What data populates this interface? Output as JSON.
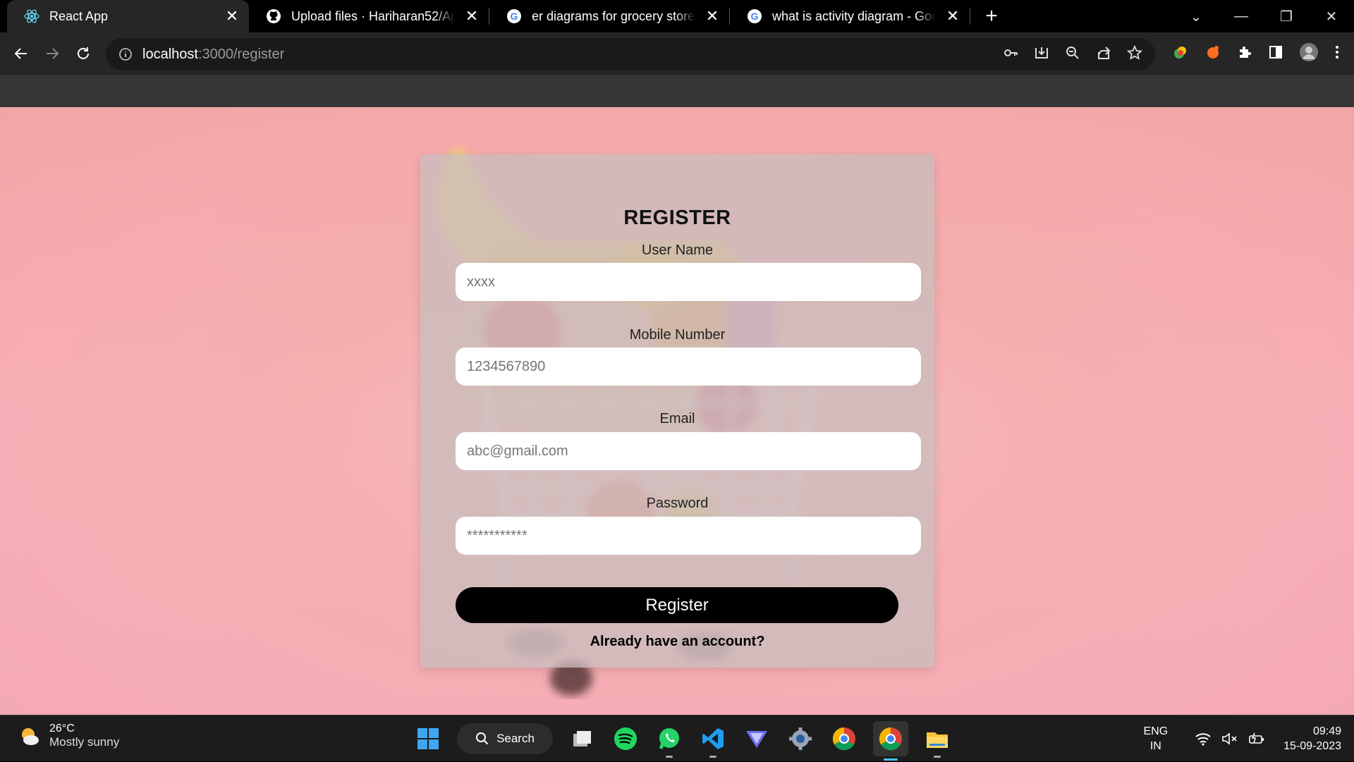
{
  "browser": {
    "tabs": [
      {
        "title": "React App",
        "favicon": "react-icon",
        "active": true
      },
      {
        "title": "Upload files · Hariharan52/AppDe",
        "favicon": "github-icon",
        "active": false
      },
      {
        "title": "er diagrams for grocery store - G",
        "favicon": "google-icon",
        "active": false
      },
      {
        "title": "what is activity diagram - Google",
        "favicon": "google-icon",
        "active": false
      }
    ],
    "url_host": "localhost",
    "url_path": ":3000/register"
  },
  "form": {
    "heading": "REGISTER",
    "username_label": "User Name",
    "username_placeholder": "xxxx",
    "mobile_label": "Mobile Number",
    "mobile_placeholder": "1234567890",
    "email_label": "Email",
    "email_placeholder": "abc@gmail.com",
    "password_label": "Password",
    "password_placeholder": "***********",
    "submit_label": "Register",
    "login_link": "Already have an account?"
  },
  "taskbar": {
    "temperature": "26°C",
    "weather": "Mostly sunny",
    "search_label": "Search",
    "lang_line1": "ENG",
    "lang_line2": "IN",
    "time": "09:49",
    "date": "15-09-2023"
  },
  "colors": {
    "page_bg": "#f5b3b3",
    "card_bg": "#c8bebe",
    "button_bg": "#000000",
    "chrome_bg": "#262626"
  }
}
